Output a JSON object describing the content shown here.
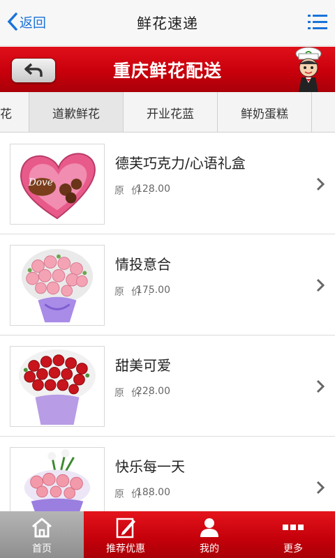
{
  "header": {
    "back_label": "返回",
    "title": "鲜花速递",
    "menu_icon": "list-menu-icon"
  },
  "banner": {
    "title": "重庆鲜花配送",
    "back_icon": "undo-arrow-icon",
    "mascot": "chef-mascot-icon",
    "color": "#c8000c"
  },
  "tabs": [
    {
      "label": "花"
    },
    {
      "label": "道歉鲜花",
      "active": true
    },
    {
      "label": "开业花蓝"
    },
    {
      "label": "鲜奶蛋糕"
    }
  ],
  "products": [
    {
      "name": "德芙巧克力/心语礼盒",
      "price_label": "原价:",
      "price": "128.00",
      "image": "heart-chocolate-box"
    },
    {
      "name": "情投意合",
      "price_label": "原价:",
      "price": "175.00",
      "image": "pink-rose-bouquet"
    },
    {
      "name": "甜美可爱",
      "price_label": "原价:",
      "price": "228.00",
      "image": "red-rose-bouquet"
    },
    {
      "name": "快乐每一天",
      "price_label": "原价:",
      "price": "188.00",
      "image": "pink-gerbera-bouquet"
    }
  ],
  "bottom_nav": [
    {
      "label": "首页",
      "icon": "home-icon",
      "active": true
    },
    {
      "label": "推荐优惠",
      "icon": "edit-note-icon"
    },
    {
      "label": "我的",
      "icon": "user-icon"
    },
    {
      "label": "更多",
      "icon": "more-dots-icon"
    }
  ]
}
